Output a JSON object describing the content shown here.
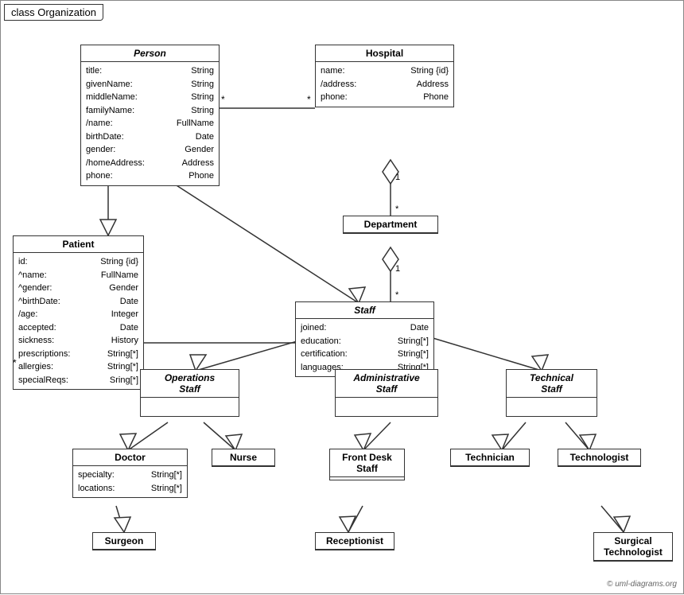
{
  "title": "class Organization",
  "copyright": "© uml-diagrams.org",
  "classes": {
    "person": {
      "name": "Person",
      "italic": true,
      "attrs": [
        {
          "name": "title:",
          "type": "String"
        },
        {
          "name": "givenName:",
          "type": "String"
        },
        {
          "name": "middleName:",
          "type": "String"
        },
        {
          "name": "familyName:",
          "type": "String"
        },
        {
          "name": "/name:",
          "type": "FullName"
        },
        {
          "name": "birthDate:",
          "type": "Date"
        },
        {
          "name": "gender:",
          "type": "Gender"
        },
        {
          "name": "/homeAddress:",
          "type": "Address"
        },
        {
          "name": "phone:",
          "type": "Phone"
        }
      ]
    },
    "hospital": {
      "name": "Hospital",
      "italic": false,
      "attrs": [
        {
          "name": "name:",
          "type": "String {id}"
        },
        {
          "name": "/address:",
          "type": "Address"
        },
        {
          "name": "phone:",
          "type": "Phone"
        }
      ]
    },
    "department": {
      "name": "Department",
      "italic": false,
      "attrs": []
    },
    "staff": {
      "name": "Staff",
      "italic": true,
      "attrs": [
        {
          "name": "joined:",
          "type": "Date"
        },
        {
          "name": "education:",
          "type": "String[*]"
        },
        {
          "name": "certification:",
          "type": "String[*]"
        },
        {
          "name": "languages:",
          "type": "String[*]"
        }
      ]
    },
    "patient": {
      "name": "Patient",
      "italic": false,
      "attrs": [
        {
          "name": "id:",
          "type": "String {id}"
        },
        {
          "name": "^name:",
          "type": "FullName"
        },
        {
          "name": "^gender:",
          "type": "Gender"
        },
        {
          "name": "^birthDate:",
          "type": "Date"
        },
        {
          "name": "/age:",
          "type": "Integer"
        },
        {
          "name": "accepted:",
          "type": "Date"
        },
        {
          "name": "sickness:",
          "type": "History"
        },
        {
          "name": "prescriptions:",
          "type": "String[*]"
        },
        {
          "name": "allergies:",
          "type": "String[*]"
        },
        {
          "name": "specialReqs:",
          "type": "Sring[*]"
        }
      ]
    },
    "operations_staff": {
      "name": "Operations Staff",
      "italic": true
    },
    "administrative_staff": {
      "name": "Administrative Staff",
      "italic": true
    },
    "technical_staff": {
      "name": "Technical Staff",
      "italic": true
    },
    "doctor": {
      "name": "Doctor",
      "italic": false,
      "attrs": [
        {
          "name": "specialty:",
          "type": "String[*]"
        },
        {
          "name": "locations:",
          "type": "String[*]"
        }
      ]
    },
    "nurse": {
      "name": "Nurse",
      "italic": false,
      "attrs": []
    },
    "front_desk_staff": {
      "name": "Front Desk Staff",
      "italic": false,
      "attrs": []
    },
    "technician": {
      "name": "Technician",
      "italic": false,
      "attrs": []
    },
    "technologist": {
      "name": "Technologist",
      "italic": false,
      "attrs": []
    },
    "surgeon": {
      "name": "Surgeon",
      "italic": false,
      "attrs": []
    },
    "receptionist": {
      "name": "Receptionist",
      "italic": false,
      "attrs": []
    },
    "surgical_technologist": {
      "name": "Surgical Technologist",
      "italic": false,
      "attrs": []
    }
  }
}
